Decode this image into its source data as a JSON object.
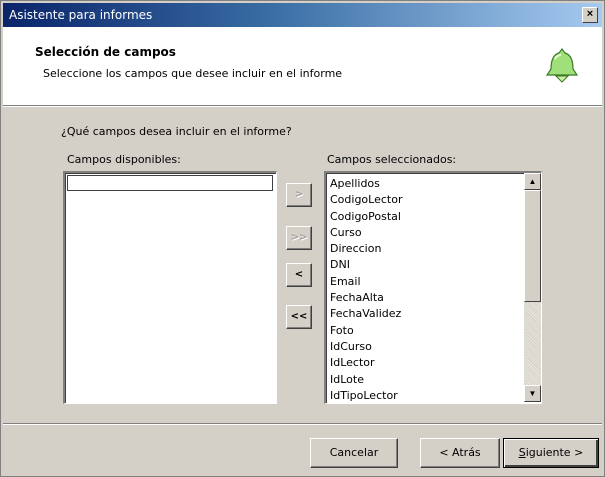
{
  "window": {
    "title": "Asistente para informes",
    "close_glyph": "×"
  },
  "header": {
    "title": "Selección de campos",
    "subtitle": "Seleccione los campos que desee incluir en el informe",
    "icon": "wizard-bell-icon"
  },
  "body": {
    "question": "¿Qué campos desea incluir en el informe?",
    "available_label": "Campos disponibles:",
    "selected_label": "Campos seleccionados:",
    "available_fields": [],
    "selected_fields": [
      "Apellidos",
      "CodigoLector",
      "CodigoPostal",
      "Curso",
      "Direccion",
      "DNI",
      "Email",
      "FechaAlta",
      "FechaValidez",
      "Foto",
      "IdCurso",
      "IdLector",
      "IdLote",
      "IdTipoLector"
    ]
  },
  "transfer_buttons": {
    "add": ">",
    "add_all": ">>",
    "remove": "<",
    "remove_all": "<<"
  },
  "footer": {
    "cancel": "Cancelar",
    "back": "< Atrás",
    "next_mnemonic": "S",
    "next_rest": "iguiente >"
  },
  "colors": {
    "titlebar_start": "#0a246a",
    "titlebar_end": "#a6caf0",
    "face": "#d4d0c8",
    "icon_green": "#7ec850"
  }
}
